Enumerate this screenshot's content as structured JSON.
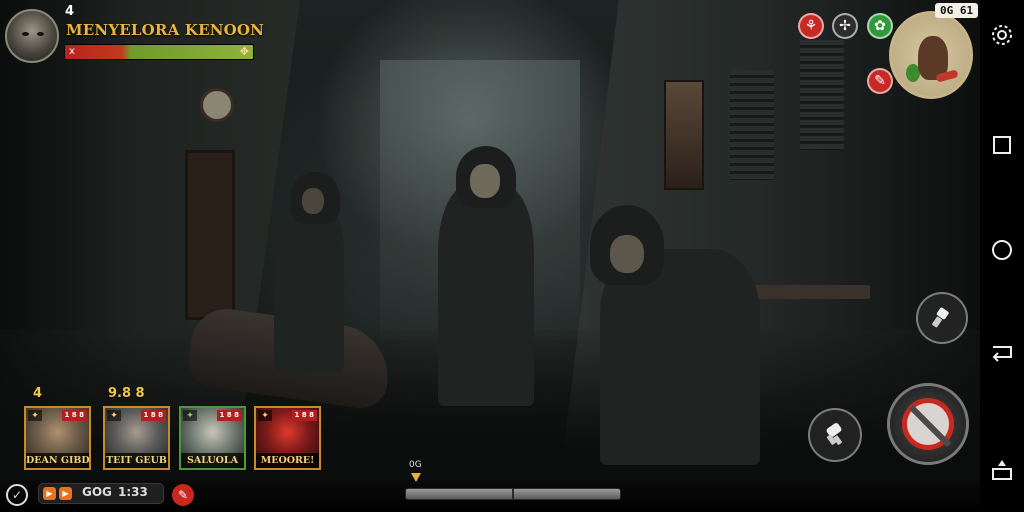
{
  "player": {
    "level": "4",
    "name": "MENYELORA KENOON",
    "hp_percent": 100,
    "hp_icon_left": "x",
    "hp_icon_right": "✥"
  },
  "top_right": {
    "clock": "0G 61",
    "skill_icons": [
      {
        "name": "red-spear-icon",
        "color": "#c72a25",
        "glyph": "⚘"
      },
      {
        "name": "crossed-tools-icon",
        "color": "#2d2d2d",
        "glyph": "✢"
      },
      {
        "name": "green-herb-icon",
        "color": "#2f9a3a",
        "glyph": "✿"
      },
      {
        "name": "red-blade-icon",
        "color": "#c72a25",
        "glyph": "✎"
      }
    ],
    "minimap_icon": "creature-with-carrot"
  },
  "team": {
    "top_labels": [
      "4",
      "9.8 8"
    ],
    "cards": [
      {
        "name": "DEAN GIBDIE",
        "badge": "1 8 8",
        "border": "#c98a2a",
        "tint": "#6a5a48"
      },
      {
        "name": "TEIT GEUB",
        "badge": "1 8 8",
        "border": "#c98a2a",
        "tint": "#5a5a58"
      },
      {
        "name": "SALUOLA",
        "badge": "1 8 8",
        "border": "#4a9a3a",
        "tint": "#6f7a70"
      },
      {
        "name": "MEOORE!",
        "badge": "1 8 8",
        "border": "#c98a2a",
        "tint": "#7a1a1a"
      }
    ]
  },
  "bottom": {
    "status_label": "GOG",
    "status_time": "1:33",
    "progress_label": "0G",
    "progress_percent": 49
  },
  "actions": {
    "primary": "attack",
    "secondary": [
      "flashlight",
      "interact-hand"
    ]
  },
  "colors": {
    "name_gold": "#e9b53c",
    "hp_red": "#b8221f",
    "hp_green": "#8fb23b",
    "attack_red": "#c8281f"
  }
}
